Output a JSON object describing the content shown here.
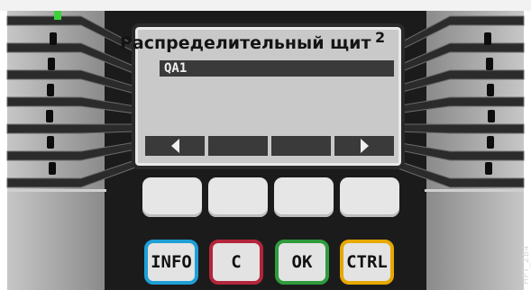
{
  "display": {
    "title": "Распределительный щит",
    "title_suffix": "2",
    "selected_item": "QA1"
  },
  "softkeys": [
    {
      "icon": "arrow-left-icon"
    },
    {
      "icon": "blank"
    },
    {
      "icon": "blank"
    },
    {
      "icon": "arrow-right-icon"
    }
  ],
  "keys": {
    "info": "INFO",
    "c": "C",
    "ok": "OK",
    "ctrl": "CTRL"
  },
  "colors": {
    "info_border": "#1e9fd6",
    "c_border": "#b3253a",
    "ok_border": "#2f9b3d",
    "ctrl_border": "#e6a800",
    "led": "#3bd13b",
    "panel": "#1a1a1a"
  },
  "figure_id": "HPT_ZB4"
}
